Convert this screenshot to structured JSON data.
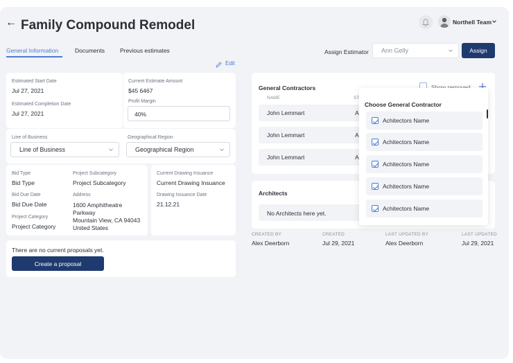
{
  "header": {
    "back_arrow": "←",
    "title": "Family Compound Remodel",
    "team_name": "Northell Team"
  },
  "tabs": [
    {
      "label": "General Information",
      "active": true
    },
    {
      "label": "Documents",
      "active": false
    },
    {
      "label": "Previous estimates",
      "active": false
    }
  ],
  "toolbar": {
    "assign_estimator_label": "Assign Estimator",
    "estimator_value": "Ann Gelly",
    "assign_button": "Assign",
    "edit_label": "Edit"
  },
  "dates_card": {
    "start_label": "Estimated Start Date",
    "start_value": "Jul 27, 2021",
    "completion_label": "Estimated Completion Date",
    "completion_value": "Jul 27, 2021"
  },
  "estimate_card": {
    "amount_label": "Current Estimate Amount",
    "amount_value": "$45 6467",
    "margin_label": "Profit Margin",
    "margin_value": "40%"
  },
  "business_card": {
    "lob_label": "Line of Business",
    "lob_value": "Line of Business",
    "region_label": "Geographical Region",
    "region_value": "Geographical Region"
  },
  "details_card": {
    "bid_type_label": "Bid Type",
    "bid_type_value": "Bid Type",
    "subcategory_label": "Project Subcategory",
    "subcategory_value": "Project Subcategory",
    "bid_due_label": "Bid Due Date",
    "bid_due_value": "Bid Due Date",
    "address_label": "Address",
    "address_line1": "1600 Amphitheatre",
    "address_line2": "Parkway",
    "address_line3": "Mountain View, CA 94043",
    "address_line4": "United States",
    "category_label": "Project Category",
    "category_value": "Project Category"
  },
  "drawing_card": {
    "insuance_label": "Current Drawing Insuance",
    "insuance_value": "Current Drawing Insuance",
    "date_label": "Drawing Issuance Date",
    "date_value": "21.12.21"
  },
  "proposals": {
    "empty_text": "There are no current proposals yet.",
    "create_button": "Create a proposal"
  },
  "contractors": {
    "title": "General Contractors",
    "show_removed": "Show removed",
    "col_name": "NAME",
    "col_status": "ST",
    "rows": [
      {
        "name": "John Lemmart",
        "status": "A"
      },
      {
        "name": "John Lemmart",
        "status": "A"
      },
      {
        "name": "John Lemmart",
        "status": "A"
      }
    ]
  },
  "dropdown": {
    "title": "Choose General Contractor",
    "items": [
      "Achitectors Name",
      "Achitectors Name",
      "Achitectors Name",
      "Achitectors Name",
      "Achitectors Name"
    ]
  },
  "architects": {
    "title": "Architects",
    "empty_text": "No Architects here yet."
  },
  "meta": {
    "created_by_label": "CREATED BY",
    "created_by_value": "Alex Deerborn",
    "created_label": "CREATED",
    "created_value": "Jul 29, 2021",
    "updated_by_label": "LAST UPDATED BY",
    "updated_by_value": "Alex Deerborn",
    "updated_label": "LAST UPDATED",
    "updated_value": "Jul 29, 2021"
  },
  "colors": {
    "primary": "#1e3a6e",
    "accent": "#4a7bd0",
    "background": "#f2f3f6"
  }
}
